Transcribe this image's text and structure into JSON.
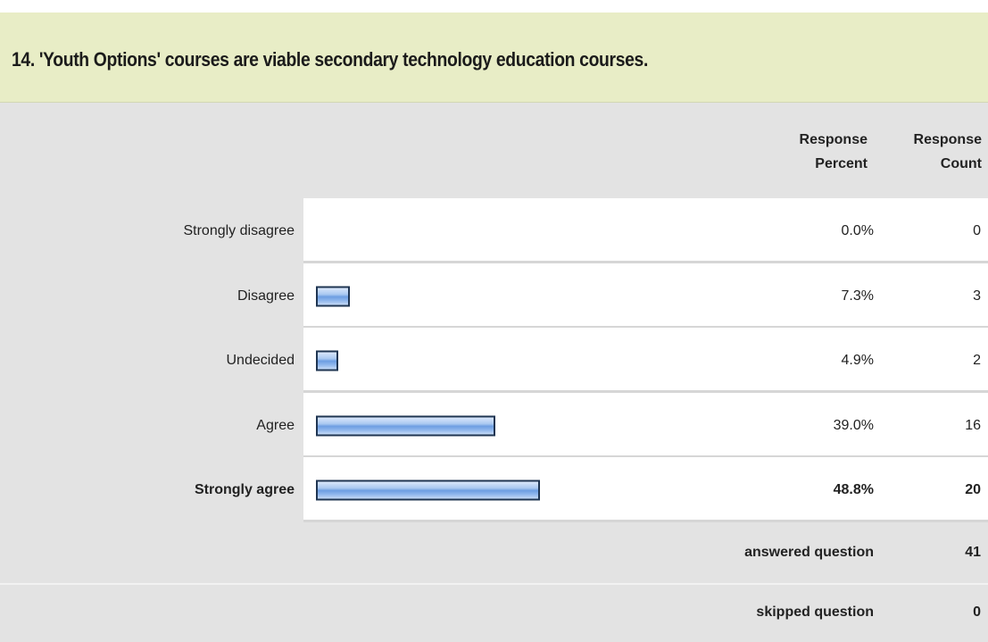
{
  "question": {
    "title": "14. 'Youth Options' courses are viable secondary technology education courses."
  },
  "columns": {
    "percent_line1": "Response",
    "percent_line2": "Percent",
    "count_line1": "Response",
    "count_line2": "Count"
  },
  "chart_data": {
    "type": "bar",
    "orientation": "horizontal",
    "categories": [
      "Strongly disagree",
      "Disagree",
      "Undecided",
      "Agree",
      "Strongly agree"
    ],
    "values": [
      0.0,
      7.3,
      4.9,
      39.0,
      48.8
    ],
    "counts": [
      0,
      3,
      2,
      16,
      20
    ],
    "percent_labels": [
      "0.0%",
      "7.3%",
      "4.9%",
      "39.0%",
      "48.8%"
    ],
    "count_labels": [
      "0",
      "3",
      "2",
      "16",
      "20"
    ],
    "highlighted_category": "Strongly agree",
    "bar_color": "#8fb6ec",
    "bar_border_color": "#1f3552"
  },
  "summary": {
    "answered_label": "answered question",
    "answered_value": "41",
    "skipped_label": "skipped question",
    "skipped_value": "0"
  },
  "colors": {
    "header_background": "#e8edc6",
    "label_background": "#e3e3e3"
  }
}
